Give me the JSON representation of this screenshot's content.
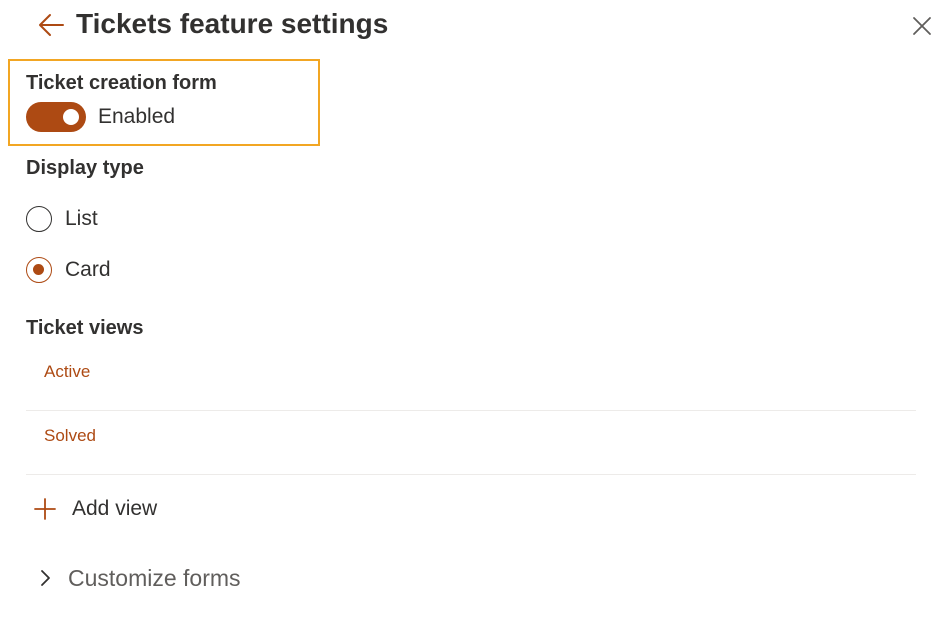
{
  "header": {
    "title": "Tickets feature settings",
    "back_icon": "arrow-left-icon",
    "close_icon": "close-icon"
  },
  "ticket_creation": {
    "label": "Ticket creation form",
    "enabled": true,
    "state_text": "Enabled"
  },
  "display_type": {
    "label": "Display type",
    "options": [
      {
        "label": "List",
        "selected": false
      },
      {
        "label": "Card",
        "selected": true
      }
    ]
  },
  "ticket_views": {
    "label": "Ticket views",
    "items": [
      {
        "label": "Active"
      },
      {
        "label": "Solved"
      }
    ],
    "add_label": "Add view"
  },
  "customize_forms": {
    "label": "Customize forms",
    "expanded": false
  },
  "colors": {
    "accent": "#ad4a13",
    "highlight": "#f2a623",
    "text": "#323130",
    "muted": "#605e5c",
    "divider": "#edebe9"
  }
}
